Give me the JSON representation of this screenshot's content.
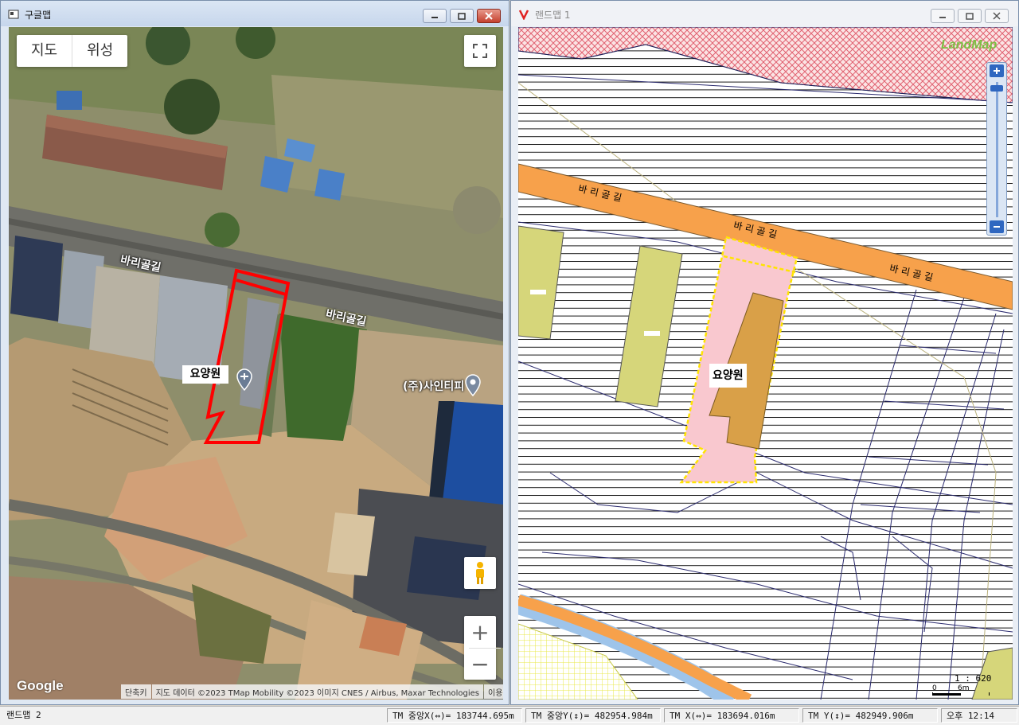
{
  "left_window": {
    "title": "구글맵",
    "map_type": {
      "map": "지도",
      "satellite": "위성"
    },
    "labels": {
      "road1": "바리골길",
      "road2": "바리골길",
      "poi_main": "요양원",
      "poi_second": "(주)사인티피"
    },
    "logo": "Google",
    "attribution": [
      "단축키",
      "지도 데이터 ©2023 TMap Mobility ©2023 이미지 CNES / Airbus, Maxar Technologies",
      "이용약관"
    ],
    "controls": {
      "fullscreen_icon": "fullscreen-icon",
      "pegman_icon": "pegman-icon",
      "zoom_in": "+",
      "zoom_out": "−"
    }
  },
  "right_window": {
    "title": "랜드맵 1",
    "logo": "LandMap",
    "road_labels": [
      "바 리 골 길",
      "바 리 골 길",
      "바 리 골 길"
    ],
    "poi_main": "요양원",
    "scale": "1 : 620",
    "scale_labels": [
      "0",
      "6m"
    ]
  },
  "statusbar": {
    "app": "랜드맵 2",
    "tm_center_x": "TM 중앙X(↔)= 183744.695m",
    "tm_center_y": "TM 중앙Y(↕)= 482954.984m",
    "tm_x": "TM X(↔)= 183694.016m",
    "tm_y": "TM Y(↕)= 482949.906m",
    "clock": "오후 12:14"
  },
  "colors": {
    "parcel_outline": "#ff0000",
    "road_fill": "#f7a14b",
    "highlight_fill": "#f9c8cf",
    "building_fill": "#d9a048",
    "parcel_green": "#d6d67a",
    "landmap_logo": "#7bc043"
  }
}
